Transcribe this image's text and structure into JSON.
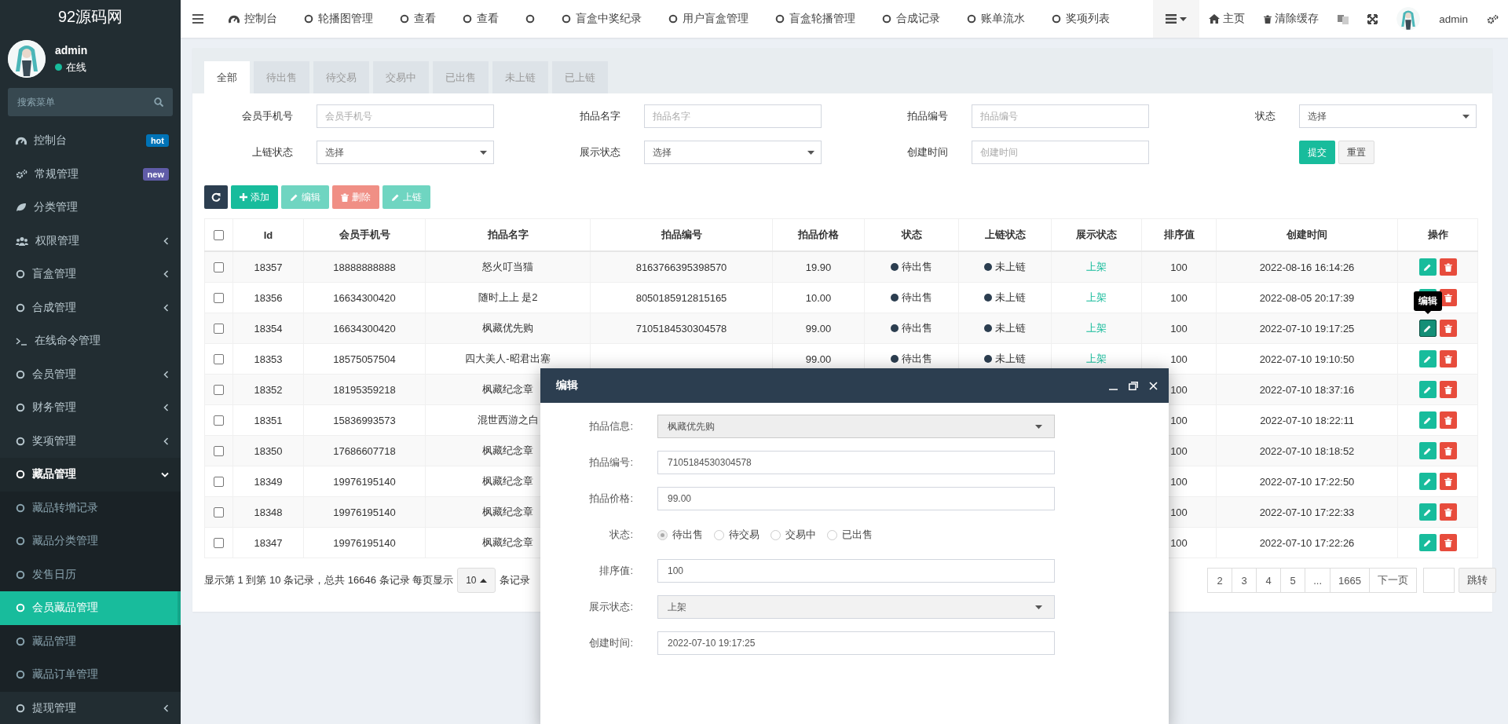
{
  "sidebar": {
    "logo": "92源码网",
    "user": {
      "name": "admin",
      "status": "在线"
    },
    "search": {
      "placeholder": "搜索菜单"
    },
    "menu": [
      {
        "label": "控制台",
        "badge": {
          "text": "hot",
          "color": "#0073b7"
        }
      },
      {
        "label": "常规管理",
        "badge": {
          "text": "new",
          "color": "#605ca8"
        }
      },
      {
        "label": "分类管理"
      },
      {
        "label": "权限管理",
        "expanded": false
      },
      {
        "label": "盲盒管理",
        "expanded": false
      },
      {
        "label": "合成管理",
        "expanded": false
      },
      {
        "label": "在线命令管理"
      },
      {
        "label": "会员管理",
        "expanded": false
      },
      {
        "label": "财务管理",
        "expanded": false
      },
      {
        "label": "奖项管理",
        "expanded": false
      },
      {
        "label": "藏品管理",
        "expanded": true,
        "children": [
          {
            "label": "藏品转增记录",
            "selected": false
          },
          {
            "label": "藏品分类管理",
            "selected": false
          },
          {
            "label": "发售日历",
            "selected": false
          },
          {
            "label": "会员藏品管理",
            "selected": true
          },
          {
            "label": "藏品管理",
            "selected": false
          },
          {
            "label": "藏品订单管理",
            "selected": false
          }
        ]
      },
      {
        "label": "提现管理",
        "expanded": false
      }
    ]
  },
  "topbar": {
    "tabs": [
      {
        "kind": "dashboard",
        "label": "控制台"
      },
      {
        "kind": "circle",
        "label": "轮播图管理"
      },
      {
        "kind": "circle",
        "label": "查看"
      },
      {
        "kind": "circle",
        "label": "查看"
      },
      {
        "kind": "circle"
      },
      {
        "kind": "circle",
        "label": "盲盒中奖纪录"
      },
      {
        "kind": "circle",
        "label": "用户盲盒管理"
      },
      {
        "kind": "circle",
        "label": "盲盒轮播管理"
      },
      {
        "kind": "circle",
        "label": "合成记录"
      },
      {
        "kind": "circle",
        "label": "账单流水"
      },
      {
        "kind": "circle",
        "label": "奖项列表"
      }
    ],
    "tools": [
      {
        "kind": "menu"
      },
      {
        "kind": "home",
        "label": "主页"
      },
      {
        "kind": "trash",
        "label": "清除缓存"
      },
      {
        "kind": "translate"
      },
      {
        "kind": "fullscreen"
      },
      {
        "kind": "user",
        "label": "admin"
      },
      {
        "kind": "settings"
      }
    ]
  },
  "panel": {
    "tabs": [
      {
        "label": "全部",
        "selected": true
      },
      {
        "label": "待出售",
        "selected": false
      },
      {
        "label": "待交易",
        "selected": false
      },
      {
        "label": "交易中",
        "selected": false
      },
      {
        "label": "已出售",
        "selected": false
      },
      {
        "label": "未上链",
        "selected": false
      },
      {
        "label": "已上链",
        "selected": false
      }
    ],
    "filters": [
      {
        "label": "会员手机号",
        "kind": "input",
        "placeholder": "会员手机号"
      },
      {
        "label": "拍品名字",
        "kind": "input",
        "placeholder": "拍品名字"
      },
      {
        "label": "拍品编号",
        "kind": "input",
        "placeholder": "拍品编号"
      },
      {
        "label": "状态",
        "kind": "select",
        "value": "选择"
      },
      {
        "label": "上链状态",
        "kind": "select",
        "value": "选择"
      },
      {
        "label": "展示状态",
        "kind": "select",
        "value": "选择"
      },
      {
        "label": "创建时间",
        "kind": "input",
        "placeholder": "创建时间"
      }
    ],
    "filter_buttons": [
      {
        "kind": "primary",
        "label": "提交"
      },
      {
        "kind": "default",
        "label": "重置"
      }
    ],
    "toolbar": [
      {
        "kind": "refresh",
        "disabled": false
      },
      {
        "kind": "add",
        "label": "添加",
        "disabled": false
      },
      {
        "kind": "edit",
        "label": "编辑",
        "disabled": true
      },
      {
        "kind": "delete",
        "label": "删除",
        "disabled": true
      },
      {
        "kind": "chain",
        "label": "上链",
        "disabled": true
      }
    ],
    "table": {
      "all_checked": false,
      "columns": [
        "Id",
        "会员手机号",
        "拍品名字",
        "拍品编号",
        "拍品价格",
        "状态",
        "上链状态",
        "展示状态",
        "排序值",
        "创建时间",
        "操作"
      ],
      "rows": [
        {
          "checked": false,
          "id": "18357",
          "phone": "18888888888",
          "name": "怒火叮当猫",
          "code": "8163766395398570",
          "price": "19.90",
          "status": "待出售",
          "chain": "未上链",
          "display": "上架",
          "sort": "100",
          "created": "2022-08-16 16:14:26",
          "edit_hovered": false
        },
        {
          "checked": false,
          "id": "18356",
          "phone": "16634300420",
          "name": "随时上上 是2",
          "code": "8050185912815165",
          "price": "10.00",
          "status": "待出售",
          "chain": "未上链",
          "display": "上架",
          "sort": "100",
          "created": "2022-08-05 20:17:39",
          "edit_hovered": false
        },
        {
          "checked": false,
          "id": "18354",
          "phone": "16634300420",
          "name": "枫藏优先购",
          "code": "7105184530304578",
          "price": "99.00",
          "status": "待出售",
          "chain": "未上链",
          "display": "上架",
          "sort": "100",
          "created": "2022-07-10 19:17:25",
          "edit_hovered": true,
          "tooltip": "编辑"
        },
        {
          "checked": false,
          "id": "18353",
          "phone": "18575057504",
          "name": "四大美人-昭君出塞",
          "price": "99.00",
          "status": "待出售",
          "chain": "未上链",
          "display": "上架",
          "sort": "100",
          "created": "2022-07-10 19:10:50",
          "edit_hovered": false
        },
        {
          "checked": false,
          "id": "18352",
          "phone": "18195359218",
          "name": "枫藏纪念章",
          "sort": "100",
          "created": "2022-07-10 18:37:16",
          "edit_hovered": false
        },
        {
          "checked": false,
          "id": "18351",
          "phone": "15836993573",
          "name": "混世西游之白",
          "sort": "100",
          "created": "2022-07-10 18:22:11",
          "edit_hovered": false
        },
        {
          "checked": false,
          "id": "18350",
          "phone": "17686607718",
          "name": "枫藏纪念章",
          "sort": "100",
          "created": "2022-07-10 18:18:52",
          "edit_hovered": false
        },
        {
          "checked": false,
          "id": "18349",
          "phone": "19976195140",
          "name": "枫藏纪念章",
          "sort": "100",
          "created": "2022-07-10 17:22:50",
          "edit_hovered": false
        },
        {
          "checked": false,
          "id": "18348",
          "phone": "19976195140",
          "name": "枫藏纪念章",
          "sort": "100",
          "created": "2022-07-10 17:22:33",
          "edit_hovered": false
        },
        {
          "checked": false,
          "id": "18347",
          "phone": "19976195140",
          "name": "枫藏纪念章",
          "sort": "100",
          "created": "2022-07-10 17:22:26",
          "edit_hovered": false
        }
      ]
    },
    "footer": {
      "summary": "显示第 1 到第 10 条记录，总共 16646 条记录 每页显示",
      "page_size": "10",
      "suffix": "条记录"
    },
    "pagination": {
      "pages": [
        "2",
        "3",
        "4",
        "5",
        "...",
        "1665",
        "下一页"
      ],
      "jump": "跳转"
    }
  },
  "modal": {
    "title": "编辑",
    "fields": [
      {
        "label": "拍品信息:",
        "kind": "select",
        "value": "枫藏优先购"
      },
      {
        "label": "拍品编号:",
        "kind": "input",
        "value": "7105184530304578"
      },
      {
        "label": "拍品价格:",
        "kind": "input",
        "value": "99.00"
      },
      {
        "label": "状态:",
        "kind": "radio",
        "options": [
          {
            "label": "待出售",
            "selected": true
          },
          {
            "label": "待交易",
            "selected": false
          },
          {
            "label": "交易中",
            "selected": false
          },
          {
            "label": "已出售",
            "selected": false
          }
        ]
      },
      {
        "label": "排序值:",
        "kind": "input",
        "value": "100"
      },
      {
        "label": "展示状态:",
        "kind": "select",
        "value": "上架"
      },
      {
        "label": "创建时间:",
        "kind": "input",
        "value": "2022-07-10 19:17:25"
      }
    ]
  }
}
